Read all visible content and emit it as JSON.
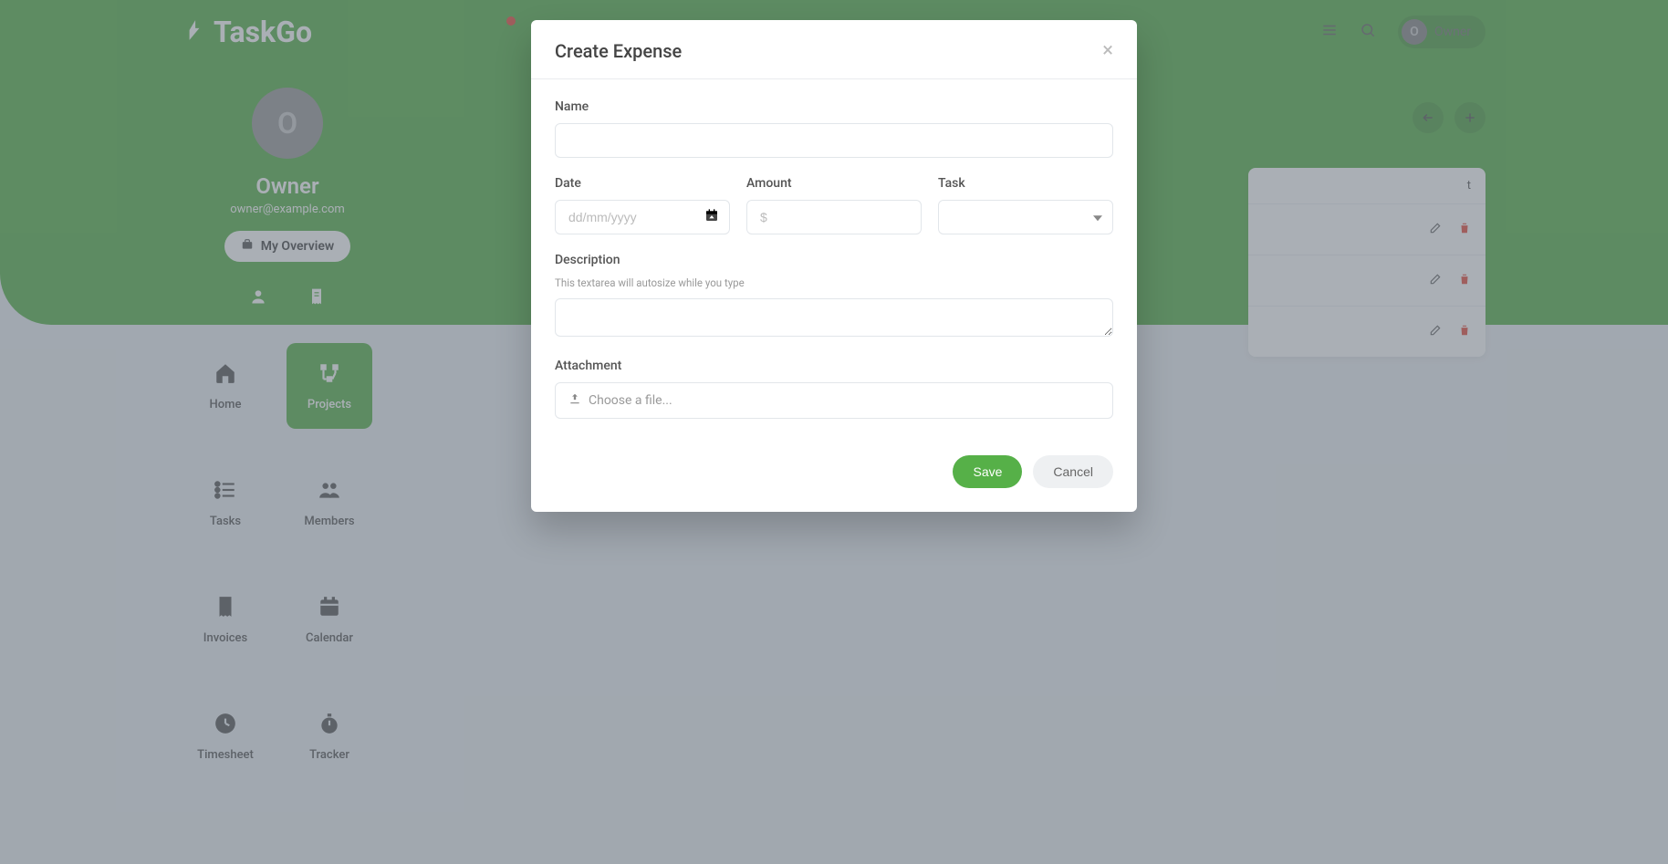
{
  "brand": {
    "name": "TaskGo"
  },
  "header": {
    "owner_chip_label": "Owner",
    "owner_chip_initial": "O"
  },
  "profile": {
    "avatar_initial": "O",
    "name": "Owner",
    "email": "owner@example.com",
    "overview_btn": "My Overview"
  },
  "nav": {
    "items": [
      {
        "key": "home",
        "label": "Home",
        "icon": "home-icon"
      },
      {
        "key": "projects",
        "label": "Projects",
        "icon": "projects-icon",
        "active": true
      },
      {
        "key": "tasks",
        "label": "Tasks",
        "icon": "tasks-icon"
      },
      {
        "key": "members",
        "label": "Members",
        "icon": "members-icon"
      },
      {
        "key": "invoices",
        "label": "Invoices",
        "icon": "invoices-icon"
      },
      {
        "key": "calendar",
        "label": "Calendar",
        "icon": "calendar-icon"
      },
      {
        "key": "timesheet",
        "label": "Timesheet",
        "icon": "clock-icon"
      },
      {
        "key": "tracker",
        "label": "Tracker",
        "icon": "stopwatch-icon"
      }
    ]
  },
  "list": {
    "header_right": "t"
  },
  "modal": {
    "title": "Create Expense",
    "labels": {
      "name": "Name",
      "date": "Date",
      "amount": "Amount",
      "task": "Task",
      "description": "Description",
      "description_help": "This textarea will autosize while you type",
      "attachment": "Attachment",
      "file_placeholder": "Choose a file...",
      "date_placeholder": "dd/mm/yyyy",
      "amount_placeholder": "$"
    },
    "buttons": {
      "save": "Save",
      "cancel": "Cancel"
    },
    "values": {
      "name": "",
      "date": "",
      "amount": "",
      "task": "",
      "description": ""
    }
  },
  "colors": {
    "primary": "#56b048",
    "danger": "#e74c3c"
  }
}
